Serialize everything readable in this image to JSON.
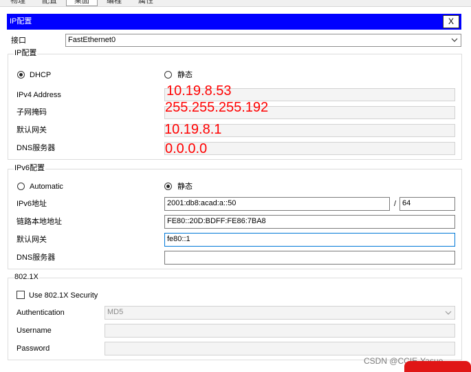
{
  "tabs": [
    "物理",
    "配置",
    "桌面",
    "编程",
    "属性"
  ],
  "active_tab": 2,
  "window": {
    "title": "IP配置",
    "close_label": "X"
  },
  "interface": {
    "label": "接口",
    "value": "FastEthernet0"
  },
  "ipv4": {
    "group_title": "IP配置",
    "dhcp_label": "DHCP",
    "static_label": "静态",
    "mode": "dhcp",
    "address_label": "IPv4 Address",
    "mask_label": "子网掩码",
    "gateway_label": "默认网关",
    "dns_label": "DNS服务器",
    "address_value": "10.19.8.53",
    "mask_value": "255.255.255.192",
    "gateway_value": "10.19.8.1",
    "dns_value": "0.0.0.0"
  },
  "ipv6": {
    "group_title": "IPv6配置",
    "auto_label": "Automatic",
    "static_label": "静态",
    "mode": "static",
    "address_label": "IPv6地址",
    "address_value": "2001:db8:acad:a::50",
    "prefix_sep": "/",
    "prefix_value": "64",
    "linklocal_label": "链路本地地址",
    "linklocal_value": "FE80::20D:BDFF:FE86:7BA8",
    "gateway_label": "默认网关",
    "gateway_value": "fe80::1",
    "dns_label": "DNS服务器",
    "dns_value": ""
  },
  "dot1x": {
    "group_title": "802.1X",
    "use_label": "Use 802.1X Security",
    "use_checked": false,
    "auth_label": "Authentication",
    "auth_value": "MD5",
    "username_label": "Username",
    "password_label": "Password"
  },
  "watermark": "CSDN @CCIE-Yasuo",
  "colors": {
    "titlebar": "#0000ff",
    "overlay": "#ff0000"
  },
  "icons": {
    "dropdown": "chevron-down-icon",
    "close": "close-icon"
  }
}
